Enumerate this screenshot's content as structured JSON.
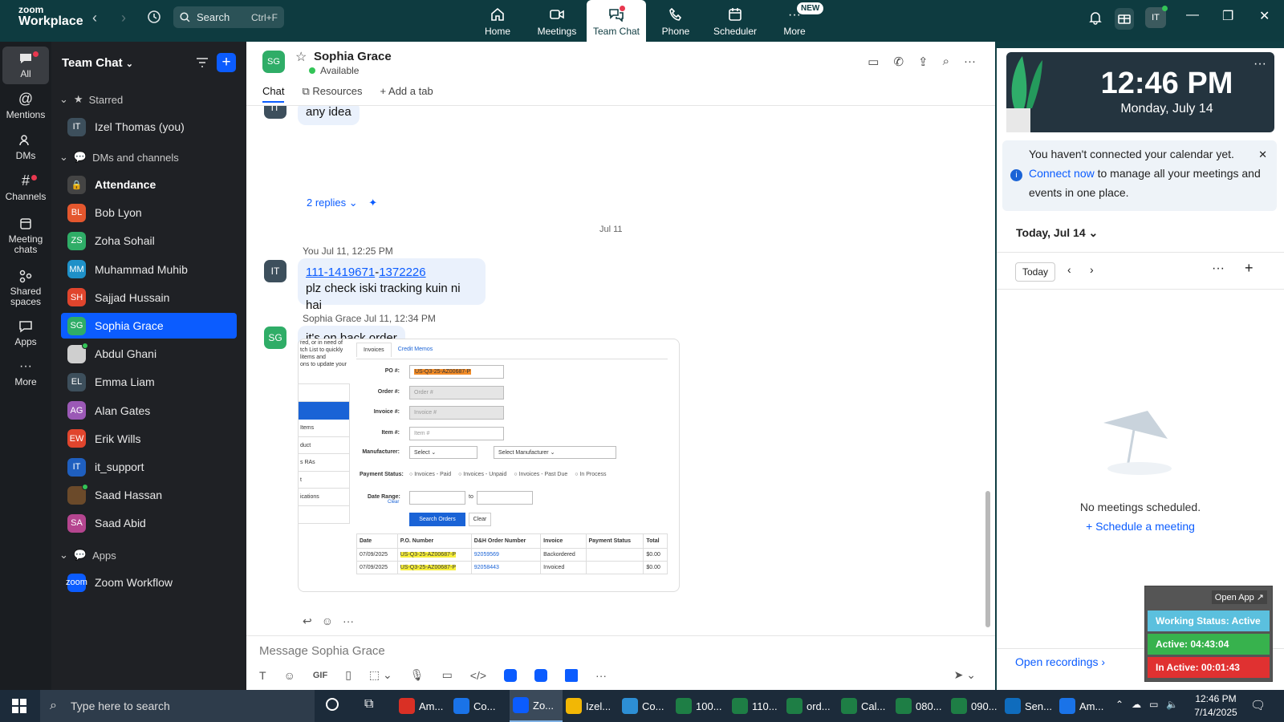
{
  "brand": {
    "line1": "zoom",
    "line2": "Workplace"
  },
  "search": {
    "label": "Search",
    "shortcut": "Ctrl+F"
  },
  "tabs": [
    {
      "label": "Home"
    },
    {
      "label": "Meetings"
    },
    {
      "label": "Team Chat"
    },
    {
      "label": "Phone"
    },
    {
      "label": "Scheduler"
    },
    {
      "label": "More",
      "badge": "NEW"
    }
  ],
  "user_initials": "IT",
  "rail": [
    "All",
    "Mentions",
    "DMs",
    "Channels",
    "Meeting chats",
    "Shared spaces",
    "Apps",
    "More"
  ],
  "sidebar": {
    "title": "Team Chat",
    "sections": {
      "starred": "Starred",
      "dms": "DMs and channels",
      "apps": "Apps"
    },
    "starred_items": [
      {
        "initials": "IT",
        "name": "Izel Thomas (you)",
        "color": "#3d4f5c"
      }
    ],
    "items": [
      {
        "initials": "",
        "name": "Attendance",
        "color": "#444"
      },
      {
        "initials": "BL",
        "name": "Bob Lyon",
        "color": "#e4572e"
      },
      {
        "initials": "ZS",
        "name": "Zoha Sohail",
        "color": "#2fad67"
      },
      {
        "initials": "MM",
        "name": "Muhammad Muhib",
        "color": "#1e90c8"
      },
      {
        "initials": "SH",
        "name": "Sajjad Hussain",
        "color": "#e0452d"
      },
      {
        "initials": "SG",
        "name": "Sophia Grace",
        "color": "#2fad67"
      },
      {
        "initials": "",
        "name": "Abdul Ghani",
        "color": "#cfcfcf"
      },
      {
        "initials": "EL",
        "name": "Emma Liam",
        "color": "#3d4f5c"
      },
      {
        "initials": "AG",
        "name": "Alan Gates",
        "color": "#9b59b6"
      },
      {
        "initials": "EW",
        "name": "Erik Wills",
        "color": "#e0452d"
      },
      {
        "initials": "IT",
        "name": "it_support",
        "color": "#1f5fbf"
      },
      {
        "initials": "",
        "name": "Saad Hassan",
        "color": "#6b4a2a"
      },
      {
        "initials": "SA",
        "name": "Saad Abid",
        "color": "#b5458f"
      }
    ],
    "app_items": [
      {
        "initials": "zoom",
        "name": "Zoom Workflow",
        "color": "#0b5cff"
      }
    ]
  },
  "chat": {
    "contact_initials": "SG",
    "contact_name": "Sophia Grace",
    "contact_status": "Available",
    "header_tabs": [
      "Chat",
      "Resources",
      "Add a tab"
    ],
    "prev_message": "any idea",
    "replies": "2 replies",
    "date_separator": "Jul 11",
    "msg1": {
      "sender": "You",
      "time": "Jul 11, 12:25 PM",
      "link1": "111-1419671",
      "dash": "-",
      "link2": "1372226",
      "text": "plz check iski tracking kuin ni hai"
    },
    "msg2": {
      "sender": "Sophia Grace",
      "time": "Jul 11, 12:34 PM",
      "text": "it's on back order"
    },
    "composer_placeholder": "Message Sophia Grace"
  },
  "screenshot": {
    "side_text": [
      "red, or in need of",
      "tch List to quickly",
      "litems and",
      "ons to update your"
    ],
    "side_menu": [
      "",
      "",
      "Items",
      "duct",
      "s RAs",
      "t",
      "ications"
    ],
    "tabs": [
      "Invoices",
      "Credit Memos"
    ],
    "fields": [
      {
        "label": "PO #:",
        "value": "US-Q3-25-AZ00687-P"
      },
      {
        "label": "Order #:",
        "value": "Order #"
      },
      {
        "label": "Invoice #:",
        "value": "Invoice #"
      },
      {
        "label": "Item #:",
        "value": "Item #"
      }
    ],
    "manufacturer_label": "Manufacturer:",
    "select1": "Select",
    "select2": "Select Manufacturer",
    "payment_label": "Payment Status:",
    "payment_options": [
      "Invoices - Paid",
      "Invoices - Unpaid",
      "Invoices - Past Due",
      "In Process"
    ],
    "date_label": "Date Range:",
    "date_clear": "Clear",
    "to": "to",
    "search_btn": "Search Orders",
    "clear_btn": "Clear",
    "table_headers": [
      "Date",
      "P.O. Number",
      "D&H Order Number",
      "Invoice",
      "Payment Status",
      "Total"
    ],
    "table_rows": [
      [
        "07/09/2025",
        "US-Q3-25-AZ00687-P",
        "92059569",
        "Backordered",
        "",
        "$0.00"
      ],
      [
        "07/09/2025",
        "US-Q3-25-AZ00687-P",
        "92058443",
        "Invoiced",
        "",
        "$0.00"
      ]
    ]
  },
  "calendar": {
    "time": "12:46 PM",
    "date": "Monday, July 14",
    "notice_pre": "You haven't connected your calendar yet.",
    "notice_link": "Connect now",
    "notice_post": "to manage all your meetings and events in one place.",
    "today_header": "Today, Jul 14",
    "today_btn": "Today",
    "no_meetings": "No meetings scheduled.",
    "schedule": "Schedule a meeting",
    "open_recordings": "Open recordings"
  },
  "status_widget": {
    "open_app": "Open App ↗",
    "working": "Working Status: Active",
    "active": "Active: 04:43:04",
    "inactive": "In Active: 00:01:43"
  },
  "taskbar": {
    "search": "Type here to search",
    "apps": [
      "Am...",
      "Co...",
      "Zo...",
      "Izel...",
      "Co...",
      "100...",
      "110...",
      "ord...",
      "Cal...",
      "080...",
      "090...",
      "Sen...",
      "Am..."
    ],
    "time": "12:46 PM",
    "date": "7/14/2025"
  }
}
